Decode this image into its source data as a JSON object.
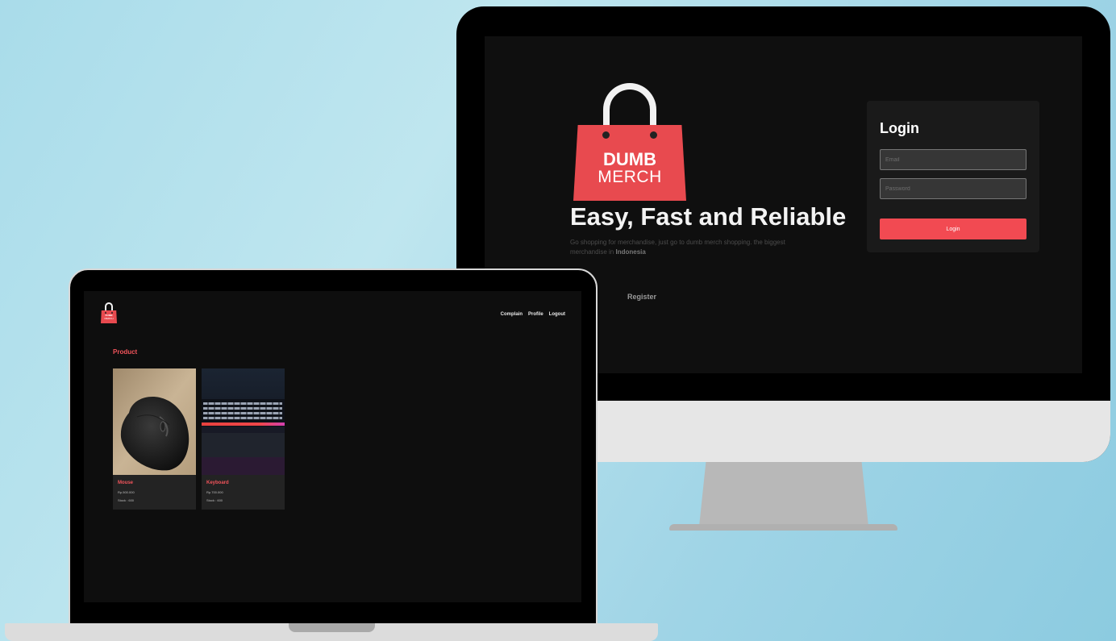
{
  "monitor": {
    "logo": {
      "line1": "DUMB",
      "line2": "MERCH"
    },
    "headline": "Easy, Fast and Reliable",
    "subtext_main": "Go shopping for merchandise, just go to dumb merch shopping. the biggest merchandise in",
    "subtext_bold": "Indonesia",
    "register_label": "Register",
    "login_card": {
      "title": "Login",
      "email_placeholder": "Email",
      "password_placeholder": "Password",
      "submit_label": "Login"
    }
  },
  "laptop": {
    "logo": {
      "line1": "DUMB",
      "line2": "MERCH"
    },
    "nav": [
      "Complain",
      "Profile",
      "Logout"
    ],
    "section_title": "Product",
    "products": [
      {
        "name": "Mouse",
        "price": "Rp.500.000",
        "stock": "Stock : 600"
      },
      {
        "name": "Keyboard",
        "price": "Rp.700.000",
        "stock": "Stock : 600"
      }
    ]
  },
  "colors": {
    "brand_red": "#e84a4f",
    "accent_red": "#f24a52",
    "screen_bg": "#0f0f0f",
    "card_bg": "#232323",
    "backdrop": "#a9dcea"
  },
  "icons": [
    "shopping-bag-logo-icon"
  ]
}
